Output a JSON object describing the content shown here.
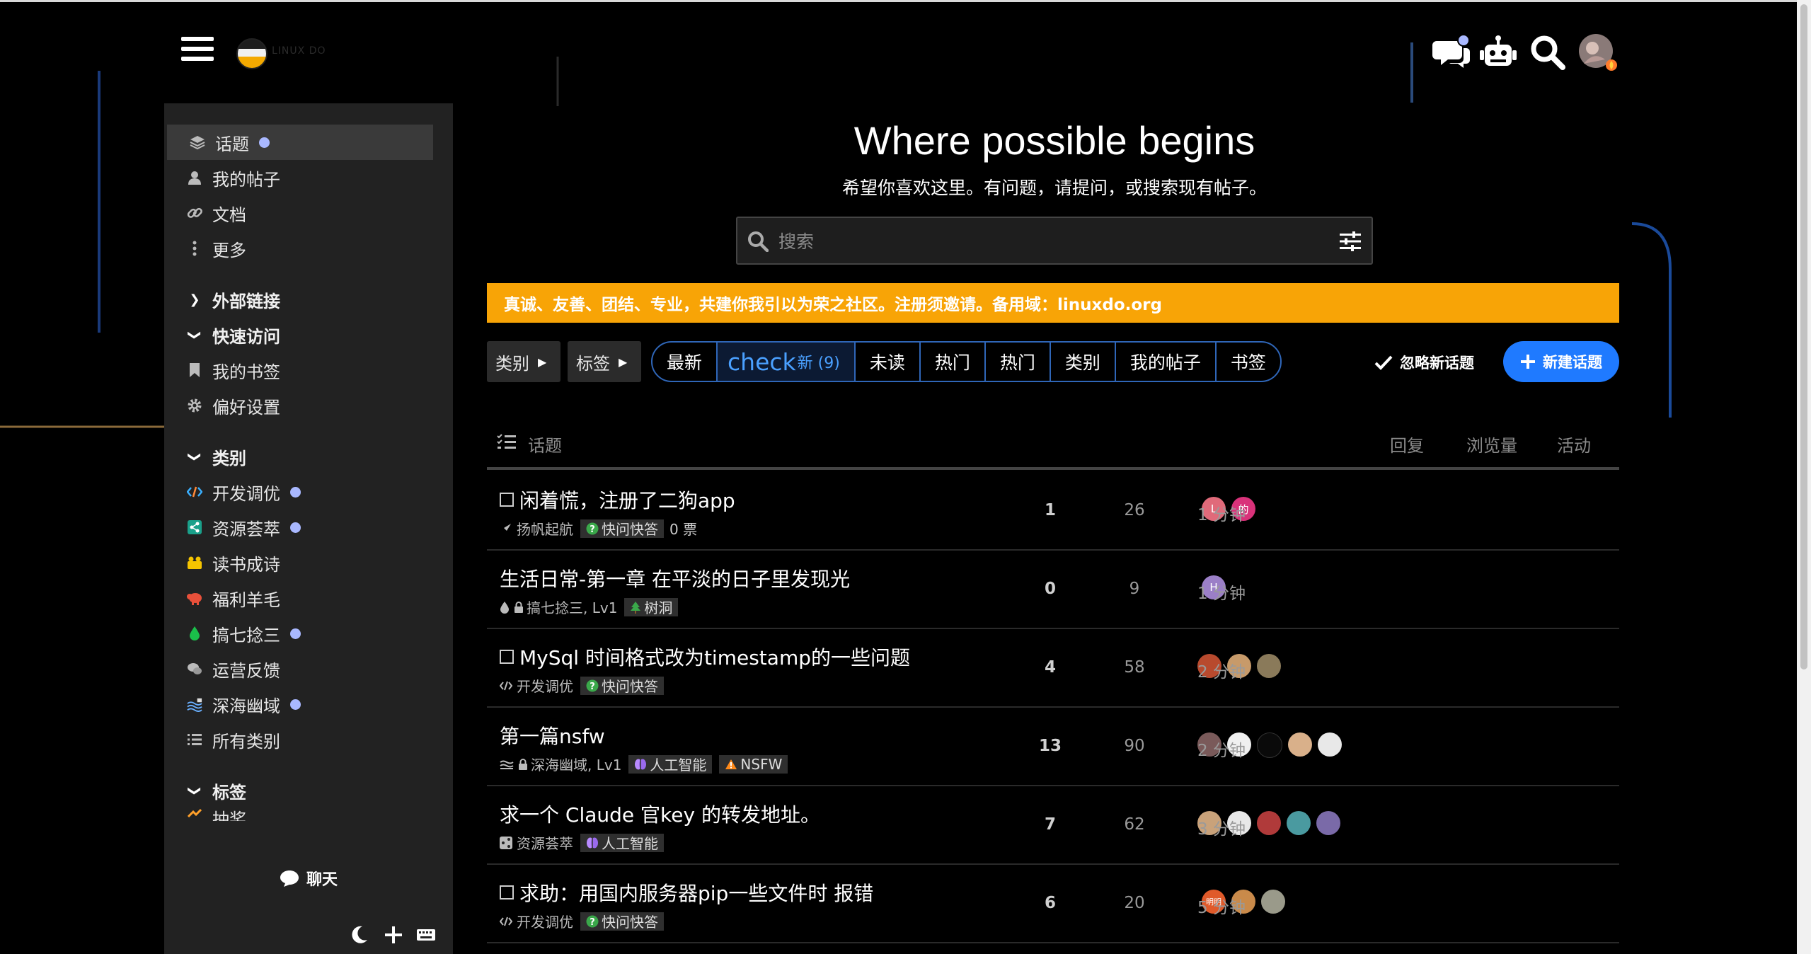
{
  "header": {
    "logo_text": "LINUX DO",
    "icons": [
      "chat-icon",
      "robot-icon",
      "search-icon",
      "user-avatar"
    ]
  },
  "sidebar": {
    "items": [
      {
        "label": "话题",
        "icon": "layers-icon",
        "dot": true,
        "active": true
      },
      {
        "label": "我的帖子",
        "icon": "user-icon"
      },
      {
        "label": "文档",
        "icon": "link-icon"
      },
      {
        "label": "更多",
        "icon": "more-icon"
      }
    ],
    "sections": {
      "external": "外部链接",
      "quick": "快速访问",
      "categories": "类别",
      "tags": "标签"
    },
    "quick_items": [
      {
        "label": "我的书签",
        "icon": "bookmark-icon"
      },
      {
        "label": "偏好设置",
        "icon": "gear-icon"
      }
    ],
    "category_items": [
      {
        "label": "开发调优",
        "icon": "code-icon",
        "dot": true
      },
      {
        "label": "资源荟萃",
        "icon": "share-icon",
        "dot": true
      },
      {
        "label": "读书成诗",
        "icon": "book-icon"
      },
      {
        "label": "福利羊毛",
        "icon": "sheep-icon"
      },
      {
        "label": "搞七捻三",
        "icon": "drop-icon",
        "dot": true
      },
      {
        "label": "运营反馈",
        "icon": "feedback-icon"
      },
      {
        "label": "深海幽域",
        "icon": "wave-icon",
        "dot": true
      },
      {
        "label": "所有类别",
        "icon": "list-icon"
      }
    ],
    "tag_partial": "抽奖",
    "chat_label": "聊天"
  },
  "hero": {
    "title": "Where possible begins",
    "subtitle": "希望你喜欢这里。有问题，请提问，或搜索现有帖子。"
  },
  "search": {
    "placeholder": "搜索"
  },
  "banner": {
    "text": "真诚、友善、团结、专业，共建你我引以为荣之社区。注册须邀请。备用域：linuxdo.org",
    "color": "#f8a406"
  },
  "nav": {
    "crumb_category": "类别",
    "crumb_tags": "标签",
    "pills": [
      "最新",
      "未读",
      "热门",
      "热门",
      "类别",
      "我的帖子",
      "书签"
    ],
    "active_pill_main": "check",
    "active_pill_sub": "新 (9)",
    "dismiss": "忽略新话题",
    "new_topic": "新建话题"
  },
  "table": {
    "headers": {
      "topic": "话题",
      "replies": "回复",
      "views": "浏览量",
      "activity": "活动"
    },
    "rows": [
      {
        "title": "闲着慌，注册了二狗app",
        "checkbox": true,
        "category": "扬帆起航",
        "locked": false,
        "tags": [
          {
            "label": "快问快答",
            "icon": "question"
          }
        ],
        "votes": "0 票",
        "avatars": [
          {
            "t": "L",
            "c": "#e06a7a"
          },
          {
            "t": "的",
            "c": "#d9327a"
          }
        ],
        "replies": "1",
        "views": "26",
        "activity": "1 分钟"
      },
      {
        "title": "生活日常-第一章 在平淡的日子里发现光",
        "checkbox": false,
        "category": "搞七捻三, Lv1",
        "locked": true,
        "tags": [
          {
            "label": "树洞",
            "icon": "tree"
          }
        ],
        "votes": "",
        "avatars": [
          {
            "t": "H",
            "c": "#9b7fc7"
          }
        ],
        "replies": "0",
        "views": "9",
        "activity": "1 分钟"
      },
      {
        "title": "MySql 时间格式改为timestamp的一些问题",
        "checkbox": true,
        "category": "开发调优",
        "locked": false,
        "tags": [
          {
            "label": "快问快答",
            "icon": "question"
          }
        ],
        "votes": "",
        "avatars": [
          {
            "t": "",
            "c": "#b84a2e"
          },
          {
            "t": "",
            "c": "#c79a6a"
          },
          {
            "t": "",
            "c": "#8a7a5a"
          }
        ],
        "replies": "4",
        "views": "58",
        "activity": "2 分钟"
      },
      {
        "title": "第一篇nsfw",
        "checkbox": false,
        "category": "深海幽域, Lv1",
        "locked": true,
        "tags": [
          {
            "label": "人工智能",
            "icon": "brain"
          },
          {
            "label": "NSFW",
            "icon": "warn"
          }
        ],
        "votes": "",
        "avatars": [
          {
            "t": "",
            "c": "#7a5a5a"
          },
          {
            "t": "",
            "c": "#f0f0f0"
          },
          {
            "t": "",
            "c": "#0a0a0a"
          },
          {
            "t": "",
            "c": "#d9b08a"
          },
          {
            "t": "",
            "c": "#e8e8e8"
          }
        ],
        "replies": "13",
        "views": "90",
        "activity": "2 分钟"
      },
      {
        "title": "求一个 Claude 官key 的转发地址。",
        "checkbox": false,
        "category": "资源荟萃",
        "locked": false,
        "tags": [
          {
            "label": "人工智能",
            "icon": "brain"
          }
        ],
        "votes": "",
        "avatars": [
          {
            "t": "",
            "c": "#c9a27a"
          },
          {
            "t": "",
            "c": "#e8e8e8"
          },
          {
            "t": "",
            "c": "#b03a3a"
          },
          {
            "t": "",
            "c": "#4a9aa0"
          },
          {
            "t": "",
            "c": "#7a6aa8"
          }
        ],
        "replies": "7",
        "views": "62",
        "activity": "3 分钟"
      },
      {
        "title": "求助：用国内服务器pip一些文件时 报错",
        "checkbox": true,
        "category": "开发调优",
        "locked": false,
        "tags": [
          {
            "label": "快问快答",
            "icon": "question"
          }
        ],
        "votes": "",
        "avatars": [
          {
            "t": "明明",
            "c": "#e05a2a"
          },
          {
            "t": "",
            "c": "#c98a4a"
          },
          {
            "t": "",
            "c": "#9a9a8a"
          }
        ],
        "replies": "6",
        "views": "20",
        "activity": "5 分钟"
      }
    ]
  }
}
